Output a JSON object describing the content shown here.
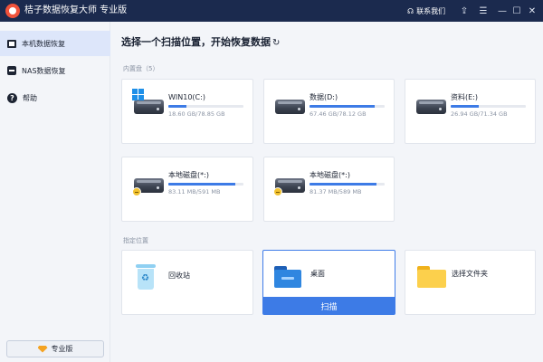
{
  "window": {
    "title": "桔子数据恢复大师 专业版",
    "contact_label": "联系我们",
    "icons": [
      "headset-icon",
      "upload-icon",
      "menu-icon",
      "minimize-icon",
      "maximize-icon",
      "close-icon"
    ]
  },
  "sidebar": {
    "items": [
      {
        "label": "本机数据恢复",
        "icon": "computer-icon",
        "active": true
      },
      {
        "label": "NAS数据恢复",
        "icon": "nas-icon",
        "active": false
      },
      {
        "label": "帮助",
        "icon": "help-icon",
        "active": false
      }
    ],
    "badge_label": "专业版"
  },
  "main": {
    "title": "选择一个扫描位置，开始恢复数据",
    "refresh_icon": "refresh-icon",
    "disks_label": "内置盘（5）",
    "disks": [
      {
        "name": "WIN10(C:)",
        "size": "18.60 GB/78.85 GB",
        "used_fraction": 0.236,
        "icon": "windows-drive-icon"
      },
      {
        "name": "数据(D:)",
        "size": "67.46 GB/78.12 GB",
        "used_fraction": 0.864,
        "icon": "drive-icon"
      },
      {
        "name": "资料(E:)",
        "size": "26.94 GB/71.34 GB",
        "used_fraction": 0.378,
        "icon": "drive-icon"
      },
      {
        "name": "本地磁盘(*:)",
        "size": "83.11 MB/591 MB",
        "used_fraction": 0.89,
        "icon": "external-drive-icon"
      },
      {
        "name": "本地磁盘(*:)",
        "size": "81.37 MB/589 MB",
        "used_fraction": 0.89,
        "icon": "external-drive-icon"
      }
    ],
    "locations_label": "指定位置",
    "locations": [
      {
        "name": "回收站",
        "icon": "recycle-bin-icon"
      },
      {
        "name": "桌面",
        "icon": "desktop-folder-icon",
        "selected": true
      },
      {
        "name": "选择文件夹",
        "icon": "folder-icon"
      }
    ],
    "scan_button": "扫描"
  },
  "colors": {
    "titlebar": "#1b2a4e",
    "accent": "#3d7be6",
    "sidebar_active": "#dde6fa",
    "background": "#f3f5f9"
  }
}
